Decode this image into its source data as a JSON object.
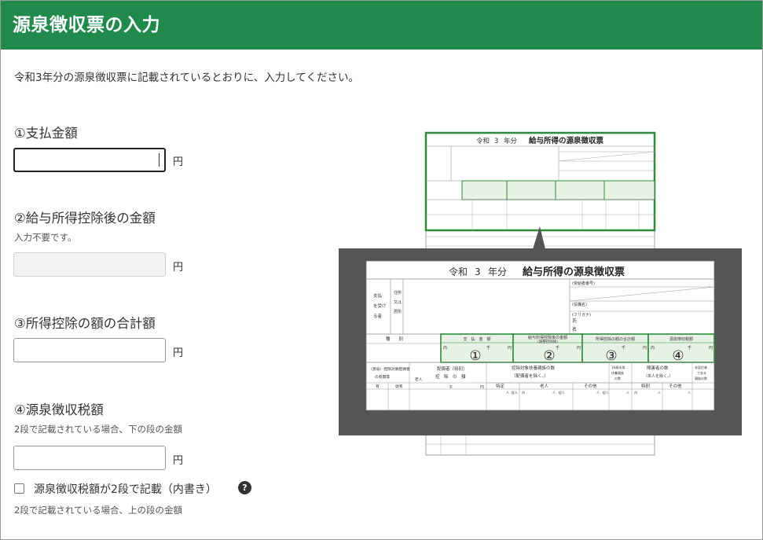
{
  "header": {
    "title": "源泉徴収票の入力"
  },
  "intro": "令和3年分の源泉徴収票に記載されているとおりに、入力してください。",
  "fields": [
    {
      "label": "①支払金額",
      "note": "",
      "value": "",
      "unit": "円"
    },
    {
      "label": "②給与所得控除後の金額",
      "note": "入力不要です。",
      "value": "",
      "unit": "円"
    },
    {
      "label": "③所得控除の額の合計額",
      "note": "",
      "value": "",
      "unit": "円"
    },
    {
      "label": "④源泉徴収税額",
      "note": "2段で記載されている場合、下の段の金額",
      "value": "",
      "unit": "円"
    }
  ],
  "checkbox": {
    "label": "源泉徴収税額が2段で記載（内書き）",
    "checked": false,
    "note": "2段で記載されている場合、上の段の金額"
  },
  "help_icon": {
    "glyph": "?"
  },
  "form_image": {
    "era": "令和",
    "year": "3",
    "year_suffix": "年分",
    "title": "給与所得の源泉徴収票",
    "recipient_labels": [
      "支払",
      "を受け",
      "る者"
    ],
    "address_label": [
      "住所",
      "又は",
      "居所"
    ],
    "number_label": "(受給者番号)",
    "position_label": "(役職名)",
    "furigana_label": "(フリガナ)",
    "name_label": [
      "氏",
      "名"
    ],
    "type_label": "種　　別",
    "columns": [
      "支　払　金　額",
      "給与所得控除後の金額",
      "所得控除の額の合計額",
      "源泉徴収税額"
    ],
    "column_sub": [
      "",
      "（調整控除後）",
      "",
      ""
    ],
    "markers": [
      "①",
      "②",
      "③",
      "④"
    ],
    "unit_labels": [
      "内",
      "千",
      "円"
    ],
    "row2_labels": [
      "（源泉）控除対象配偶者",
      "の有無等",
      "配偶者（特別）",
      "控　除　の　額",
      "控除対象扶養親族の数",
      "（配偶者を除く。）",
      "16歳未満",
      "扶養親族",
      "の数",
      "障害者の数",
      "（本人を除く。）",
      "非居住者",
      "である",
      "親族の数"
    ],
    "row3_labels": [
      "有",
      "従有",
      "老人",
      "千",
      "円",
      "特定",
      "老人",
      "その他",
      "特別",
      "その他"
    ],
    "row3_small": [
      "人",
      "従人",
      "内",
      "人",
      "従人",
      "人",
      "従人",
      "人",
      "内",
      "人",
      "人"
    ],
    "colors": {
      "accent": "#1f8a4c",
      "form_green": "#2e8b3e",
      "zoom_bg": "#555555"
    }
  }
}
